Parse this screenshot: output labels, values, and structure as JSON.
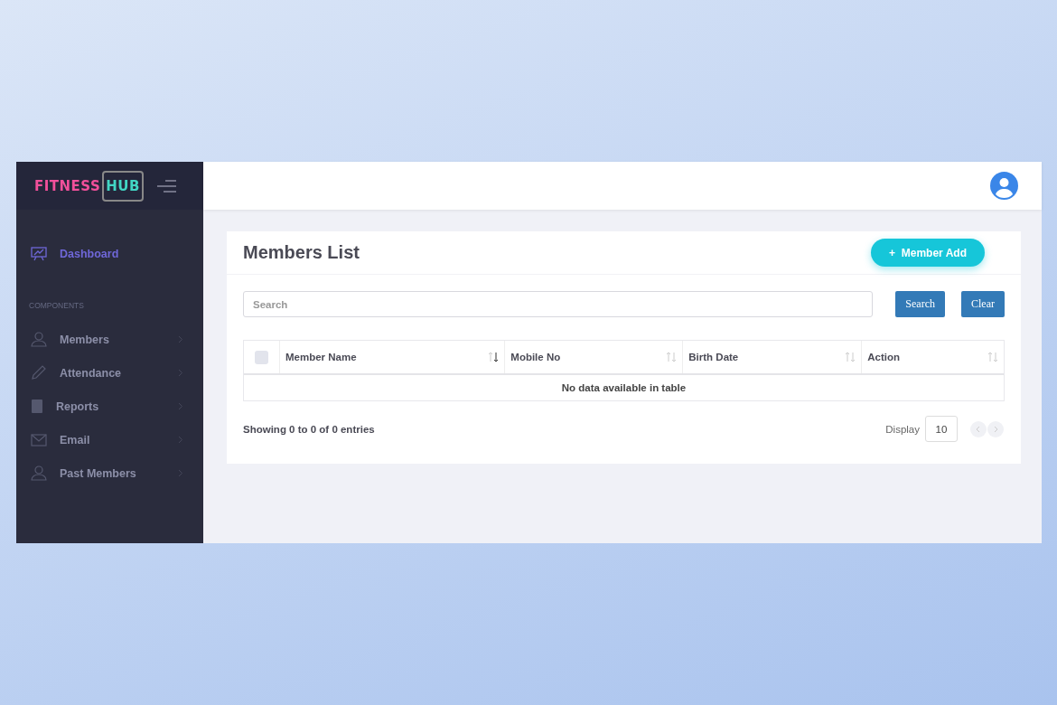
{
  "brand": {
    "word_1": "FITNESS",
    "word_2": "HUB"
  },
  "sidebar": {
    "items": [
      {
        "label": "Dashboard",
        "selected": true,
        "has_arrow": false
      }
    ],
    "section": "COMPONENTS",
    "components": [
      {
        "label": "Members",
        "selected": false,
        "has_arrow": true
      },
      {
        "label": "Attendance",
        "selected": false,
        "has_arrow": true
      },
      {
        "label": "Reports",
        "selected": false,
        "has_arrow": true
      },
      {
        "label": "Email",
        "selected": false,
        "has_arrow": true
      },
      {
        "label": "Past Members",
        "selected": false,
        "has_arrow": true
      }
    ]
  },
  "card": {
    "title": "Members List",
    "add_button": "+  Member Add",
    "search": {
      "placeholder": "Search"
    },
    "buttons": [
      "Search",
      "Clear"
    ],
    "table": {
      "select_all": {
        "checked": false
      },
      "columns": [
        {
          "label": "Member Name",
          "sorted": true
        },
        {
          "label": "Mobile No",
          "sorted": false
        },
        {
          "label": "Birth Date",
          "sorted": false
        },
        {
          "label": "Action",
          "sorted": false
        }
      ],
      "empty": "No data available in table"
    },
    "info": "Showing 0 to 0 of 0 entries",
    "display_label": "Display",
    "page_size": "10"
  }
}
